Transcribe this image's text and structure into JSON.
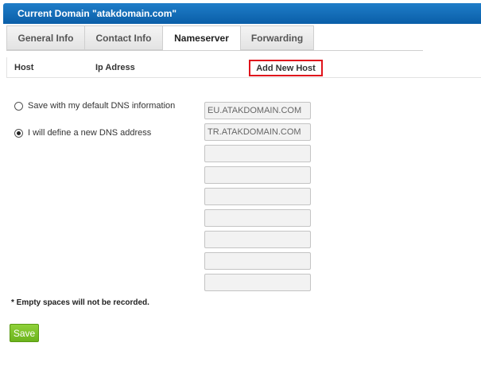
{
  "header": {
    "title": "Current Domain \"atakdomain.com\"",
    "accent_color": "#0a5ea8"
  },
  "tabs": [
    {
      "label": "General Info",
      "active": false
    },
    {
      "label": "Contact Info",
      "active": false
    },
    {
      "label": "Nameserver",
      "active": true
    },
    {
      "label": "Forwarding",
      "active": false
    }
  ],
  "columns": {
    "host": "Host",
    "ip": "Ip Adress",
    "add_new_host": "Add New Host",
    "highlight_color": "#e0141c"
  },
  "options": {
    "default_dns": {
      "label": "Save with my default DNS information",
      "selected": false
    },
    "new_dns": {
      "label": "I will define a new DNS address",
      "selected": true
    }
  },
  "nameservers": [
    {
      "value": "EU.ATAKDOMAIN.COM"
    },
    {
      "value": "TR.ATAKDOMAIN.COM"
    },
    {
      "value": ""
    },
    {
      "value": ""
    },
    {
      "value": ""
    },
    {
      "value": ""
    },
    {
      "value": ""
    },
    {
      "value": ""
    },
    {
      "value": ""
    }
  ],
  "note": "* Empty spaces will not be recorded.",
  "save_label": "Save",
  "save_color": "#6bb31c"
}
